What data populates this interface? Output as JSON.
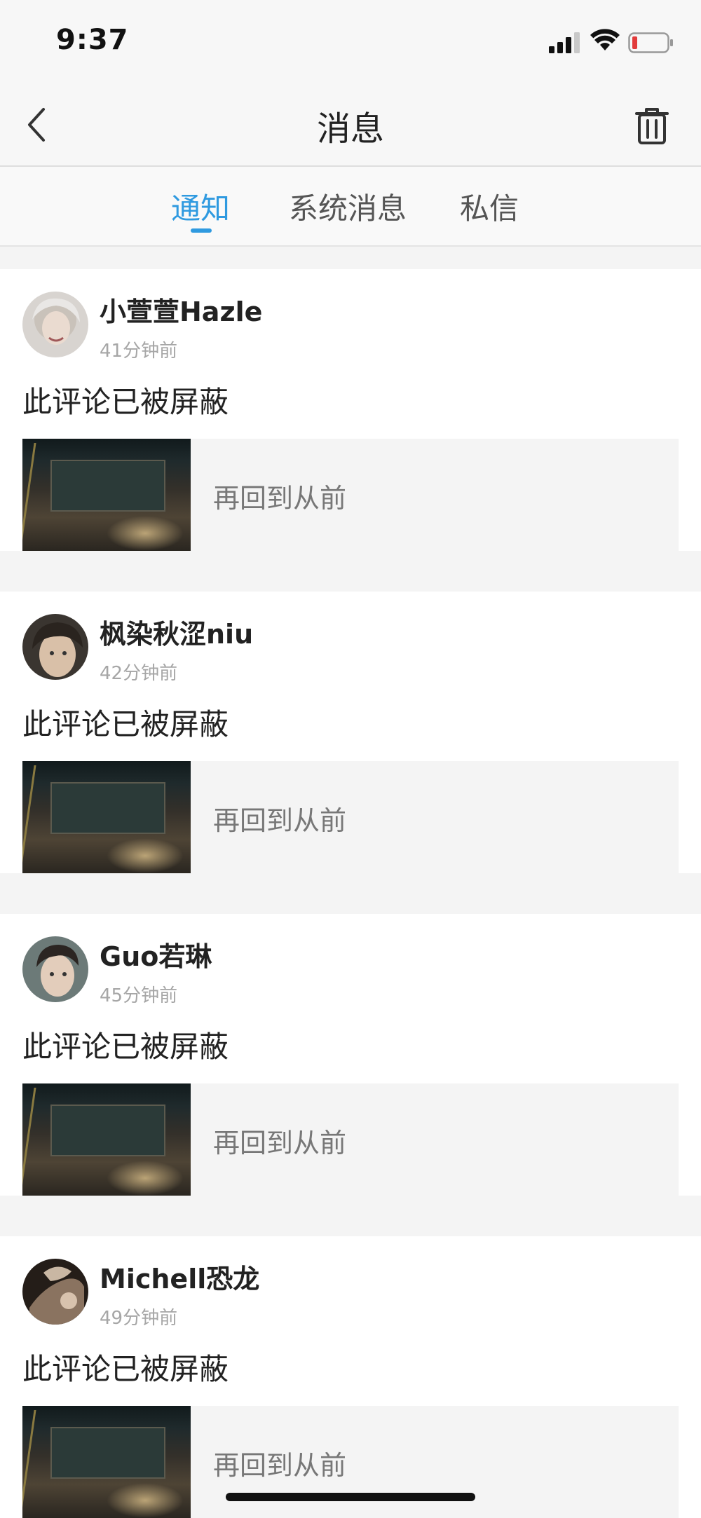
{
  "status_bar": {
    "time": "9:37"
  },
  "navbar": {
    "title": "消息"
  },
  "tabs": [
    {
      "label": "通知",
      "active": true
    },
    {
      "label": "系统消息",
      "active": false
    },
    {
      "label": "私信",
      "active": false
    }
  ],
  "notifications": [
    {
      "username": "小萱萱Hazle",
      "time_ago": "41分钟前",
      "comment": "此评论已被屏蔽",
      "ref_title": "再回到从前"
    },
    {
      "username": "枫染秋涩niu",
      "time_ago": "42分钟前",
      "comment": "此评论已被屏蔽",
      "ref_title": "再回到从前"
    },
    {
      "username": "Guo若琳",
      "time_ago": "45分钟前",
      "comment": "此评论已被屏蔽",
      "ref_title": "再回到从前"
    },
    {
      "username": "Michell恐龙",
      "time_ago": "49分钟前",
      "comment": "此评论已被屏蔽",
      "ref_title": "再回到从前"
    }
  ],
  "colors": {
    "accent": "#2f9ae0",
    "battery_low": "#e23b3b"
  }
}
